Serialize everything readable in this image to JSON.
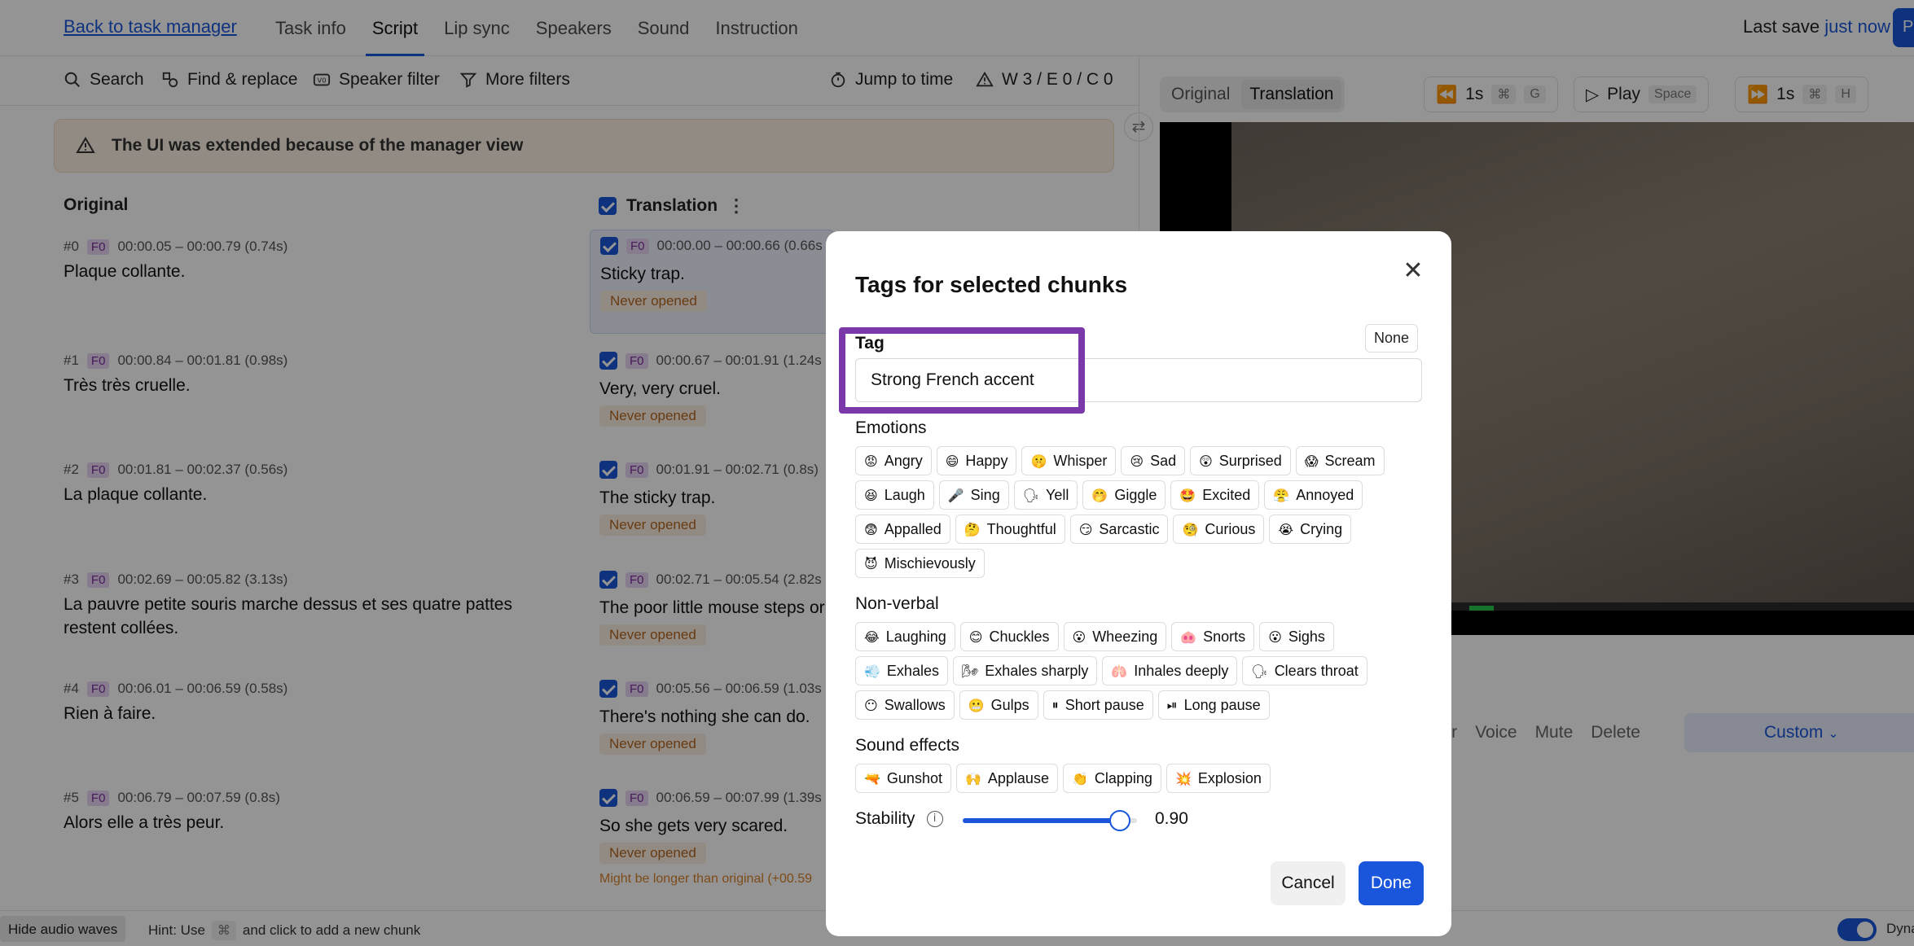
{
  "nav": {
    "back_label": "Back to task manager",
    "tabs": [
      "Task info",
      "Script",
      "Lip sync",
      "Speakers",
      "Sound",
      "Instruction"
    ],
    "active_tab": "Script",
    "last_save_label": "Last save",
    "last_save_time": "just now",
    "publish_glyph": "P"
  },
  "toolbar": {
    "search": "Search",
    "find_replace": "Find & replace",
    "speaker_filter": "Speaker filter",
    "more_filters": "More filters",
    "jump_to_time": "Jump to time",
    "status": "W 3 / E 0 / C 0"
  },
  "banner": {
    "text": "The UI was extended because of the manager view"
  },
  "columns": {
    "original": "Original",
    "translation": "Translation"
  },
  "original_chunks": [
    {
      "index": "#0",
      "speaker": "F0",
      "time": "00:00.05 – 00:00.79 (0.74s)",
      "text": "Plaque collante."
    },
    {
      "index": "#1",
      "speaker": "F0",
      "time": "00:00.84 – 00:01.81 (0.98s)",
      "text": "Très très cruelle."
    },
    {
      "index": "#2",
      "speaker": "F0",
      "time": "00:01.81 – 00:02.37 (0.56s)",
      "text": "La plaque collante."
    },
    {
      "index": "#3",
      "speaker": "F0",
      "time": "00:02.69 – 00:05.82 (3.13s)",
      "text": "La pauvre petite souris marche dessus et ses quatre pattes restent collées."
    },
    {
      "index": "#4",
      "speaker": "F0",
      "time": "00:06.01 – 00:06.59 (0.58s)",
      "text": "Rien à faire."
    },
    {
      "index": "#5",
      "speaker": "F0",
      "time": "00:06.79 – 00:07.59 (0.8s)",
      "text": "Alors elle a très peur."
    }
  ],
  "translation_chunks": [
    {
      "speaker": "F0",
      "time": "00:00.00 – 00:00.66 (0.66s",
      "text": "Sticky trap.",
      "status": "Never opened"
    },
    {
      "speaker": "F0",
      "time": "00:00.67 – 00:01.91 (1.24s",
      "text": "Very, very cruel.",
      "status": "Never opened"
    },
    {
      "speaker": "F0",
      "time": "00:01.91 – 00:02.71 (0.8s)",
      "text": "The sticky trap.",
      "status": "Never opened"
    },
    {
      "speaker": "F0",
      "time": "00:02.71 – 00:05.54 (2.82s",
      "text": "The poor little mouse steps or",
      "status": "Never opened"
    },
    {
      "speaker": "F0",
      "time": "00:05.56 – 00:06.59 (1.03s",
      "text": "There's nothing she can do.",
      "status": "Never opened"
    },
    {
      "speaker": "F0",
      "time": "00:06.59 – 00:07.99 (1.39s",
      "text": "So she gets very scared.",
      "status": "Never opened",
      "warning": "Might be longer than original (+00.59"
    }
  ],
  "player": {
    "view_original": "Original",
    "view_translation": "Translation",
    "rewind": "1s",
    "rewind_keys": [
      "⌘",
      "G"
    ],
    "play": "Play",
    "play_key": "Space",
    "forward": "1s",
    "forward_keys": [
      "⌘",
      "H"
    ],
    "progress": 0.41
  },
  "chunk_actions": [
    "ker",
    "Voice",
    "Mute",
    "Delete"
  ],
  "custom_label": "Custom",
  "footer": {
    "hide_waves": "Hide audio waves",
    "hint_prefix": "Hint: Use",
    "hint_key": "⌘",
    "hint_suffix": "and click to add a new chunk",
    "toggle_label": "Dyna"
  },
  "modal": {
    "title": "Tags for selected chunks",
    "close_glyph": "✕",
    "tag_label": "Tag",
    "none_label": "None",
    "tag_value": "Strong French accent",
    "emotions_label": "Emotions",
    "emotions": [
      {
        "emoji": "😡",
        "label": "Angry"
      },
      {
        "emoji": "😄",
        "label": "Happy"
      },
      {
        "emoji": "🤫",
        "label": "Whisper"
      },
      {
        "emoji": "😢",
        "label": "Sad"
      },
      {
        "emoji": "😲",
        "label": "Surprised"
      },
      {
        "emoji": "😱",
        "label": "Scream"
      },
      {
        "emoji": "😆",
        "label": "Laugh"
      },
      {
        "emoji": "🎤",
        "label": "Sing"
      },
      {
        "emoji": "🗣",
        "label": "Yell"
      },
      {
        "emoji": "🤭",
        "label": "Giggle"
      },
      {
        "emoji": "🤩",
        "label": "Excited"
      },
      {
        "emoji": "😤",
        "label": "Annoyed"
      },
      {
        "emoji": "😨",
        "label": "Appalled"
      },
      {
        "emoji": "🤔",
        "label": "Thoughtful"
      },
      {
        "emoji": "😏",
        "label": "Sarcastic"
      },
      {
        "emoji": "🧐",
        "label": "Curious"
      },
      {
        "emoji": "😭",
        "label": "Crying"
      },
      {
        "emoji": "😈",
        "label": "Mischievously"
      }
    ],
    "nonverbal_label": "Non-verbal",
    "nonverbal": [
      {
        "emoji": "😂",
        "label": "Laughing"
      },
      {
        "emoji": "😊",
        "label": "Chuckles"
      },
      {
        "emoji": "😮",
        "label": "Wheezing"
      },
      {
        "emoji": "🐽",
        "label": "Snorts"
      },
      {
        "emoji": "😮",
        "label": "Sighs"
      },
      {
        "emoji": "💨",
        "label": "Exhales"
      },
      {
        "emoji": "🌬",
        "label": "Exhales sharply"
      },
      {
        "emoji": "🫁",
        "label": "Inhales deeply"
      },
      {
        "emoji": "🗣",
        "label": "Clears throat"
      },
      {
        "emoji": "😶",
        "label": "Swallows"
      },
      {
        "emoji": "😬",
        "label": "Gulps"
      },
      {
        "emoji": "⏸",
        "label": "Short pause"
      },
      {
        "emoji": "⏯",
        "label": "Long pause"
      }
    ],
    "sfx_label": "Sound effects",
    "sfx": [
      {
        "emoji": "🔫",
        "label": "Gunshot"
      },
      {
        "emoji": "🙌",
        "label": "Applause"
      },
      {
        "emoji": "👏",
        "label": "Clapping"
      },
      {
        "emoji": "💥",
        "label": "Explosion"
      }
    ],
    "stability_label": "Stability",
    "stability_info": "i",
    "stability_value": 0.9,
    "stability_display": "0.90",
    "cancel_label": "Cancel",
    "done_label": "Done"
  },
  "colors": {
    "accent": "#1a56db",
    "highlight": "#7b38a8",
    "warning": "#b5651d"
  }
}
